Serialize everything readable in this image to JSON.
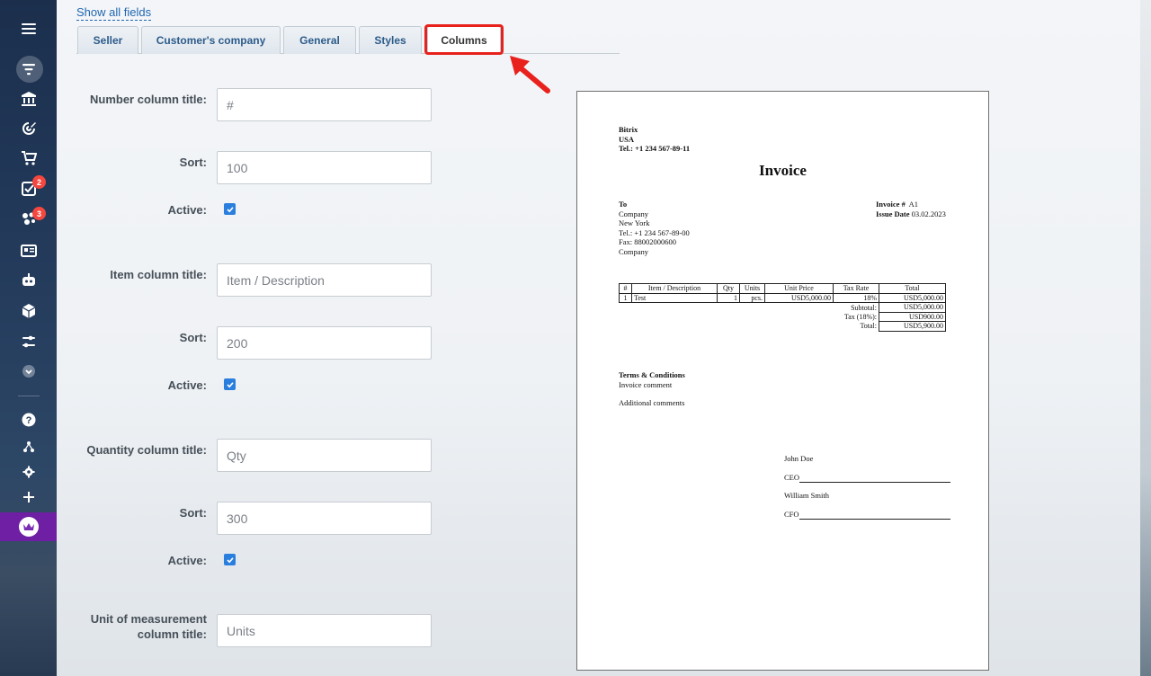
{
  "sidebar": {
    "tasks_badge": "2",
    "crm_badge": "3"
  },
  "main": {
    "show_all_fields": "Show all fields",
    "tabs": [
      {
        "label": "Seller"
      },
      {
        "label": "Customer's company"
      },
      {
        "label": "General"
      },
      {
        "label": "Styles"
      },
      {
        "label": "Columns"
      }
    ]
  },
  "form": {
    "number": {
      "title_label": "Number column title:",
      "title_value": "#",
      "sort_label": "Sort:",
      "sort_value": "100",
      "active_label": "Active:"
    },
    "item": {
      "title_label": "Item column title:",
      "title_value": "Item / Description",
      "sort_label": "Sort:",
      "sort_value": "200",
      "active_label": "Active:"
    },
    "quantity": {
      "title_label": "Quantity column title:",
      "title_value": "Qty",
      "sort_label": "Sort:",
      "sort_value": "300",
      "active_label": "Active:"
    },
    "unit": {
      "title_label_1": "Unit of measurement",
      "title_label_2": "column title:",
      "title_value": "Units"
    }
  },
  "invoice": {
    "seller_name": "Bitrix",
    "seller_country": "USA",
    "seller_phone": "Tel.: +1 234 567-89-11",
    "title": "Invoice",
    "to_label": "To",
    "to_company": "Company",
    "to_city": "New York",
    "to_phone": "Tel.: +1 234 567-89-00",
    "to_fax": "Fax: 88002000600",
    "to_company2": "Company",
    "invoice_no_label": "Invoice #",
    "invoice_no": "A1",
    "issue_date_label": "Issue Date",
    "issue_date": "03.02.2023",
    "table_headers": [
      "#",
      "Item / Description",
      "Qty",
      "Units",
      "Unit Price",
      "Tax Rate",
      "Total"
    ],
    "row": [
      "1",
      "Test",
      "1",
      "pcs.",
      "USD5,000.00",
      "18%",
      "USD5,000.00"
    ],
    "subtotal_label": "Subtotal:",
    "subtotal": "USD5,000.00",
    "tax_label": "Tax (18%):",
    "tax": "USD900.00",
    "total_label": "Total:",
    "total": "USD5,900.00",
    "terms_title": "Terms & Conditions",
    "terms_comment": "Invoice comment",
    "additional_comments": "Additional comments",
    "signer1_name": "John Doe",
    "signer1_role": "CEO",
    "signer2_name": "William Smith",
    "signer2_role": "CFO"
  },
  "colors": {
    "accent_blue": "#2067b0",
    "highlight_red": "#e8211d",
    "badge_red": "#f4473f",
    "checkbox_blue": "#2a7fde",
    "sidebar_bg": "#243b5c"
  }
}
